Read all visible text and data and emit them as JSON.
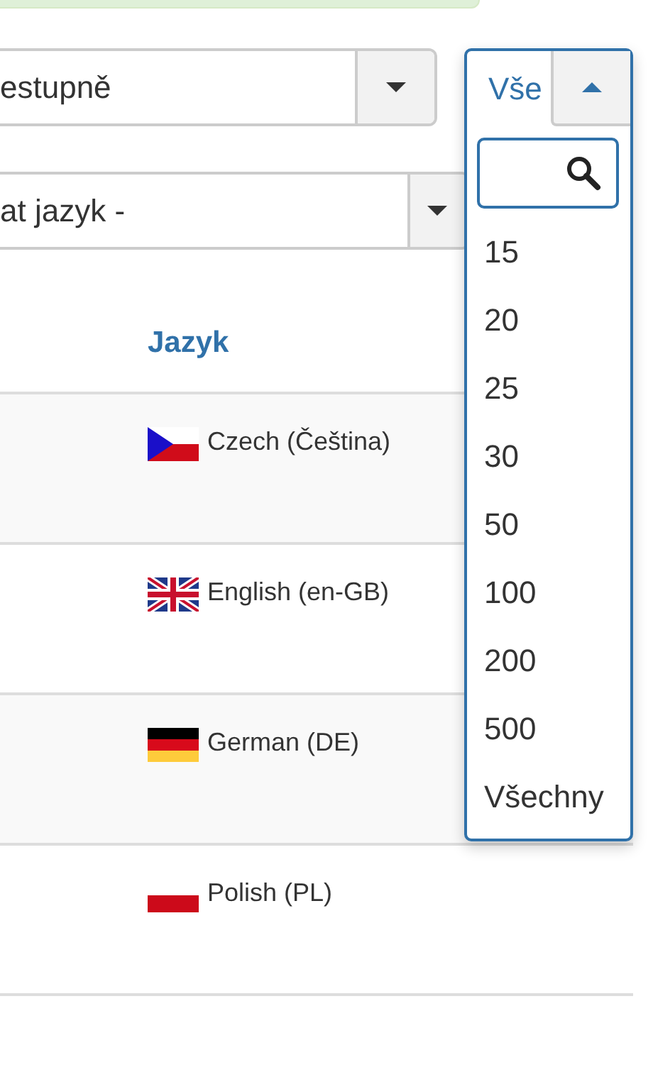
{
  "ordering_select": {
    "value": "estupně"
  },
  "language_select": {
    "value": "at jazyk -"
  },
  "limit_select": {
    "value": "Vše",
    "expanded": true,
    "options": [
      "15",
      "20",
      "25",
      "30",
      "50",
      "100",
      "200",
      "500",
      "Všechny"
    ]
  },
  "table": {
    "columns": [
      "Jazyk"
    ],
    "rows": [
      {
        "language": "Czech (Čeština)",
        "kind": "cz"
      },
      {
        "language": "English (en-GB)",
        "kind": "gb"
      },
      {
        "language": "German (DE)",
        "kind": "de"
      },
      {
        "language": "Polish (PL)",
        "kind": "pl"
      }
    ]
  }
}
